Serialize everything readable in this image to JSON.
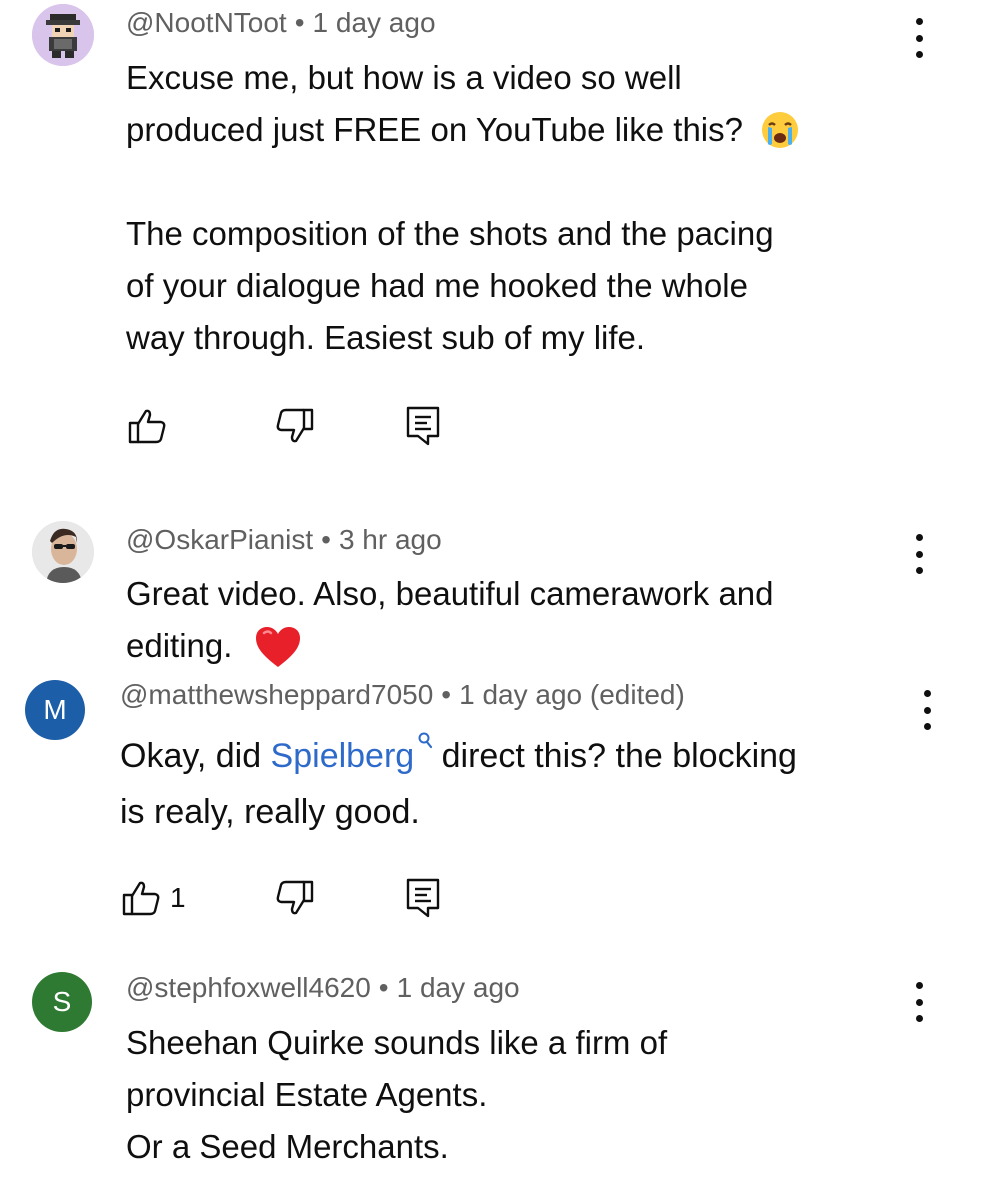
{
  "comments": [
    {
      "author": "@NootNToot",
      "time": "1 day ago",
      "lines": [
        "Excuse me, but how is a video so well",
        "produced just FREE on YouTube like this?",
        "",
        "The composition of the shots and the pacing",
        "of your dialogue had me hooked the whole",
        "way through. Easiest sub of my life."
      ],
      "emoji": "crying-face-emoji"
    },
    {
      "author": "@OskarPianist",
      "time": "3 hr ago",
      "lines": [
        "Great video. Also, beautiful camerawork and",
        "editing."
      ],
      "emoji": "red-heart-emoji"
    },
    {
      "author": "@matthewsheppard7050",
      "time": "1 day ago (edited)",
      "avatar_letter": "M",
      "avatar_color": "#1d5ea8",
      "line1_before": "Okay, did ",
      "line1_link": "Spielberg",
      "line1_after": " direct this? the blocking",
      "line2": "is realy, really good.",
      "like_count": "1"
    },
    {
      "author": "@stephfoxwell4620",
      "time": "1 day ago",
      "avatar_letter": "S",
      "avatar_color": "#2f7a32",
      "lines": [
        "Sheehan Quirke sounds like a firm of",
        "provincial Estate Agents.",
        "Or a Seed Merchants."
      ]
    }
  ],
  "separator": "•",
  "colors": {
    "text": "#0f0f0f",
    "meta": "#606060",
    "link": "#2e6ac9"
  }
}
